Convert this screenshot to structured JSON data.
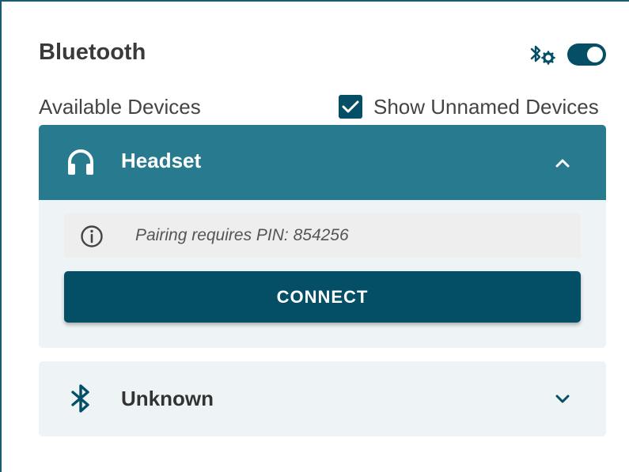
{
  "panel": {
    "title": "Bluetooth",
    "enabled": true
  },
  "devices_section": {
    "label": "Available Devices",
    "show_unnamed_label": "Show Unnamed Devices",
    "show_unnamed_checked": true
  },
  "devices": [
    {
      "name": "Headset",
      "icon": "headphones-icon",
      "expanded": true,
      "info_text": "Pairing requires PIN: 854256",
      "connect_label": "CONNECT"
    },
    {
      "name": "Unknown",
      "icon": "bluetooth-icon",
      "expanded": false
    }
  ],
  "colors": {
    "primary": "#054f66",
    "header_expanded": "#287a8e",
    "card_bg": "#eef4f5",
    "info_bg": "#eeeeee"
  }
}
